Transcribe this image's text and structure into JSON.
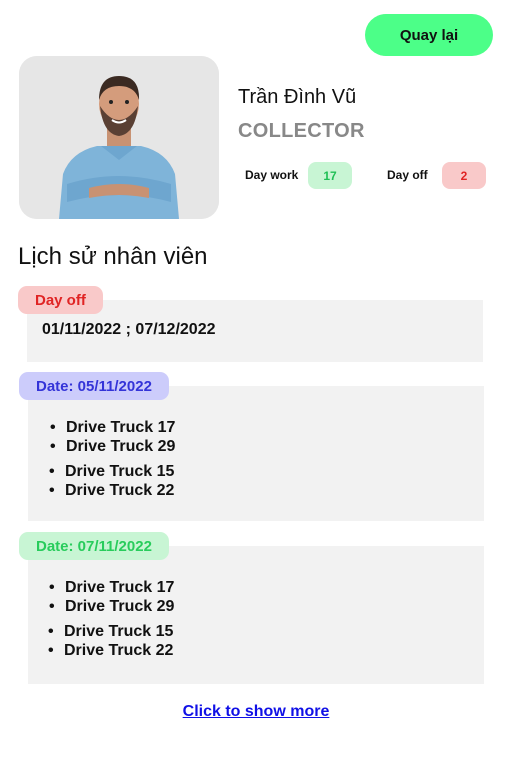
{
  "header": {
    "back_label": "Quay lại"
  },
  "profile": {
    "name": "Trần Đình Vũ",
    "role": "COLLECTOR",
    "day_work_label": "Day work",
    "day_work_value": "17",
    "day_off_label": "Day off",
    "day_off_value": "2"
  },
  "history": {
    "title": "Lịch sử nhân viên",
    "day_off": {
      "tag": "Day off",
      "range": "01/11/2022 ; 07/12/2022"
    },
    "entries": [
      {
        "date_label": "Date: 05/11/2022",
        "items": [
          "Drive Truck 17",
          "Drive Truck 29",
          "Drive Truck 15",
          "Drive Truck 22"
        ]
      },
      {
        "date_label": "Date: 07/11/2022",
        "items": [
          "Drive Truck 17",
          "Drive Truck 29",
          "Drive Truck 15",
          "Drive Truck 22"
        ]
      }
    ]
  },
  "footer": {
    "show_more_label": "Click to show more"
  },
  "colors": {
    "accent_green": "#4cff88",
    "badge_green": "#c8f5d4",
    "badge_red": "#f9c9c9",
    "badge_blue": "#ccccfb",
    "link_blue": "#1010e6"
  }
}
